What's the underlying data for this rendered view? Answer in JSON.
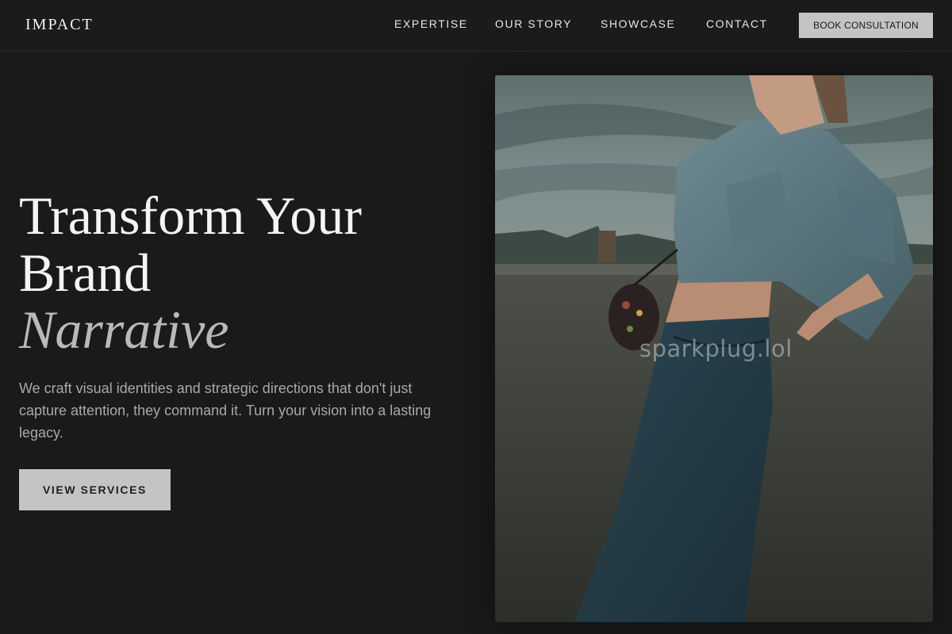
{
  "brand": {
    "logo": "IMPACT"
  },
  "nav": {
    "links": [
      "EXPERTISE",
      "OUR STORY",
      "SHOWCASE",
      "CONTACT"
    ],
    "cta": "BOOK CONSULTATION"
  },
  "hero": {
    "title_line1": "Transform Your",
    "title_line2": "Brand",
    "title_accent": "Narrative",
    "description": "We craft visual identities and strategic directions that don't just capture attention, they command it. Turn your vision into a lasting legacy.",
    "button": "VIEW SERVICES"
  },
  "image": {
    "description": "photo",
    "watermark": "sparkplug.lol"
  },
  "colors": {
    "background": "#1a1a1a",
    "button": "#c4c4c4",
    "text_primary": "#f4f4f4",
    "text_muted": "#a7a9ac"
  }
}
